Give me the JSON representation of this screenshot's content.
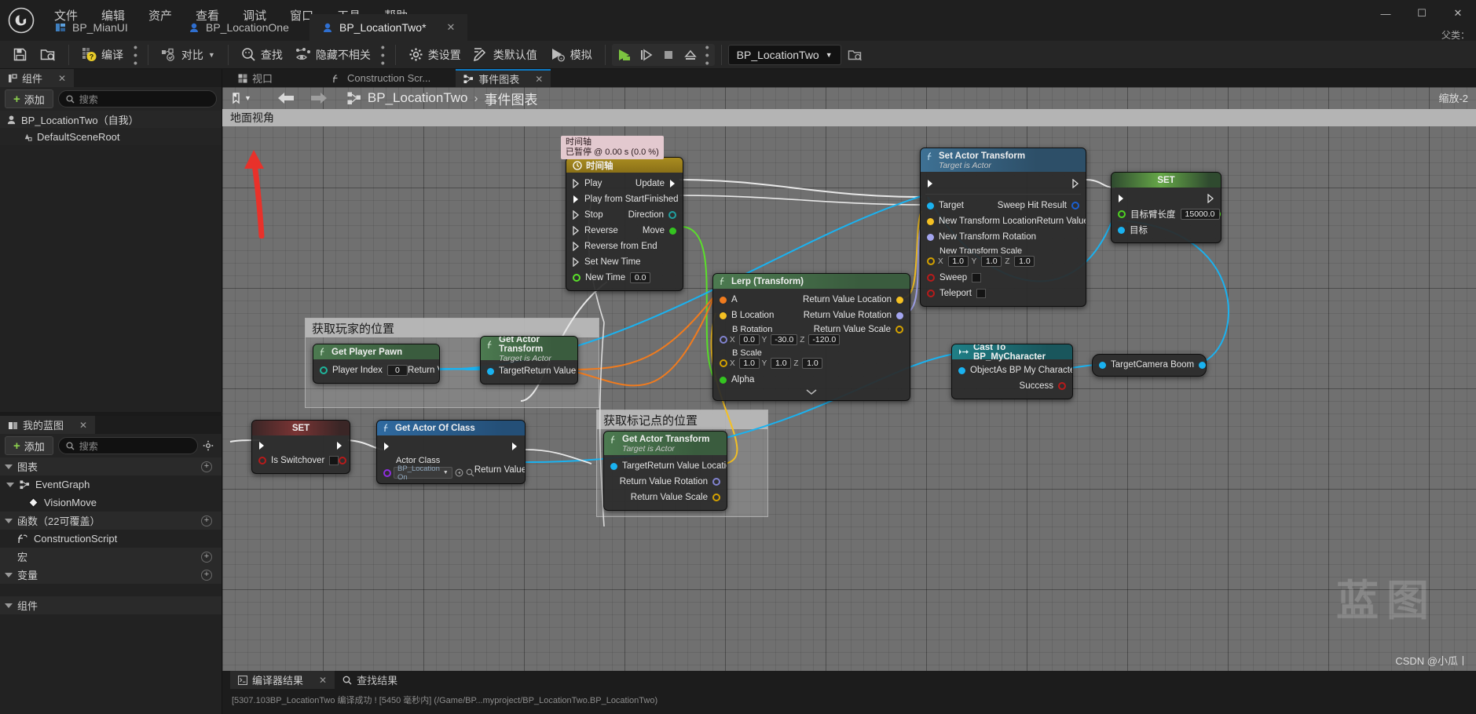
{
  "app": {
    "logo": "unreal-engine-logo",
    "menu": [
      "文件",
      "编辑",
      "资产",
      "查看",
      "调试",
      "窗口",
      "工具",
      "帮助"
    ],
    "window_buttons": {
      "minimize": "—",
      "maximize": "☐",
      "close": "✕"
    },
    "parent_class_label": "父类："
  },
  "asset_tabs": [
    {
      "label": "BP_MianUI",
      "icon": "widget-icon",
      "active": false,
      "closable": false
    },
    {
      "label": "BP_LocationOne",
      "icon": "blueprint-actor-icon",
      "active": false,
      "closable": false
    },
    {
      "label": "BP_LocationTwo*",
      "icon": "blueprint-actor-icon",
      "active": true,
      "closable": true,
      "close": "✕"
    }
  ],
  "toolbar": {
    "save": "保存",
    "browse": "在内容浏览器中浏览",
    "compile": "编译",
    "diff": "对比",
    "find": "查找",
    "hide_unrelated": "隐藏不相关",
    "class_settings": "类设置",
    "class_defaults": "类默认值",
    "simulate": "模拟",
    "play": "运行",
    "step": "逐帧",
    "stop": "停止",
    "eject": "弹出",
    "debug_filter": "BP_LocationTwo",
    "debug_filter_search": "search-icon"
  },
  "components_panel": {
    "tab_label": "组件",
    "tab_close": "✕",
    "add_label": "添加",
    "search_placeholder": "搜索",
    "items": [
      {
        "label": "BP_LocationTwo（自我）",
        "icon": "blueprint-actor-icon",
        "depth": 0
      },
      {
        "label": "DefaultSceneRoot",
        "icon": "scene-root-icon",
        "depth": 1
      }
    ]
  },
  "myblueprint_panel": {
    "tab_label": "我的蓝图",
    "tab_close": "✕",
    "add_label": "添加",
    "search_placeholder": "搜索",
    "settings_icon": "gear-icon",
    "sections": [
      {
        "label": "图表",
        "expandable": true,
        "has_add": true,
        "items": [
          {
            "label": "EventGraph",
            "icon": "event-graph-icon",
            "depth": 1,
            "expandable": true
          },
          {
            "label": "VisionMove",
            "icon": "event-node-icon",
            "depth": 2
          }
        ]
      },
      {
        "label": "函数（22可覆盖）",
        "expandable": true,
        "has_add": true,
        "items": [
          {
            "label": "ConstructionScript",
            "icon": "function-icon",
            "depth": 1
          }
        ]
      },
      {
        "label": "宏",
        "expandable": false,
        "has_add": true,
        "items": []
      },
      {
        "label": "变量",
        "expandable": true,
        "has_add": true,
        "items": []
      },
      {
        "label": "组件",
        "expandable": true,
        "has_add": false,
        "items": []
      }
    ]
  },
  "graph_tabs": [
    {
      "label": "视口",
      "icon": "viewport-icon",
      "active": false
    },
    {
      "label": "Construction Scr...",
      "icon": "function-icon",
      "active": false
    },
    {
      "label": "事件图表",
      "icon": "event-graph-icon",
      "active": true,
      "close": "✕"
    }
  ],
  "graph_header": {
    "bookmark_icon": "bookmark-icon",
    "back_icon": "arrow-left-icon",
    "forward_icon": "arrow-right-icon",
    "graph_icon": "event-graph-icon",
    "breadcrumb_root": "BP_LocationTwo",
    "breadcrumb_sep": "›",
    "breadcrumb_leaf": "事件图表",
    "zoom_label": "缩放-2",
    "ground_view_label": "地面视角",
    "watermark": "蓝图",
    "csdn": "CSDN @小瓜丨"
  },
  "comments": [
    {
      "id": "player-pos",
      "title": "获取玩家的位置"
    },
    {
      "id": "marker-pos",
      "title": "获取标记点的位置"
    }
  ],
  "timeline_tooltip": {
    "line1": "时间轴",
    "line2": "已暂停 @ 0.00 s (0.0 %)"
  },
  "nodes": {
    "timeline": {
      "title": "时间轴",
      "icon": "clock-icon",
      "inputs": [
        "Play",
        "Play from Start",
        "Stop",
        "Reverse",
        "Reverse from End",
        "Set New Time"
      ],
      "new_time_label": "New Time",
      "new_time_value": "0.0",
      "outputs": [
        "Update",
        "Finished",
        "Direction",
        "Move"
      ]
    },
    "set_actor_transform": {
      "title": "Set Actor Transform",
      "subtitle": "Target is Actor",
      "icon": "function-f-icon",
      "inputs": [
        "Target",
        "New Transform Location",
        "New Transform Rotation"
      ],
      "scale_label": "New Transform Scale",
      "scale": {
        "x": "1.0",
        "y": "1.0",
        "z": "1.0"
      },
      "sweep_label": "Sweep",
      "teleport_label": "Teleport",
      "outputs": [
        "Sweep Hit Result",
        "Return Value"
      ]
    },
    "set_arm_length": {
      "title": "SET",
      "value_label": "目标臂长度",
      "value": "15000.0",
      "target_label": "目标"
    },
    "lerp_transform": {
      "title": "Lerp (Transform)",
      "icon": "function-f-icon",
      "inputs": [
        "A",
        "B Location"
      ],
      "b_rotation_label": "B Rotation",
      "b_rotation": {
        "x": "0.0",
        "y": "-30.0",
        "z": "-120.0"
      },
      "b_scale_label": "B Scale",
      "b_scale": {
        "x": "1.0",
        "y": "1.0",
        "z": "1.0"
      },
      "alpha_label": "Alpha",
      "outputs": [
        "Return Value Location",
        "Return Value Rotation",
        "Return Value Scale"
      ],
      "expand_icon": "chevron-down-icon"
    },
    "get_player_pawn": {
      "title": "Get Player Pawn",
      "icon": "function-f-icon",
      "input_label": "Player Index",
      "input_value": "0",
      "output_label": "Return Value"
    },
    "get_actor_transform_player": {
      "title": "Get Actor Transform",
      "subtitle": "Target is Actor",
      "icon": "function-f-icon",
      "input_label": "Target",
      "output_label": "Return Value"
    },
    "get_actor_transform_marker": {
      "title": "Get Actor Transform",
      "subtitle": "Target is Actor",
      "icon": "function-f-icon",
      "input_label": "Target",
      "outputs": [
        "Return Value Location",
        "Return Value Rotation",
        "Return Value Scale"
      ]
    },
    "set_is_switchover": {
      "title": "SET",
      "label": "Is Switchover",
      "checked": false
    },
    "get_actor_of_class": {
      "title": "Get Actor Of Class",
      "icon": "function-f-icon",
      "class_label": "Actor Class",
      "class_value": "BP_Location On",
      "dropdown_icon": "chevron-down-icon",
      "browse_icon": "browse-icon",
      "search_icon": "search-icon",
      "output_label": "Return Value"
    },
    "cast_to_character": {
      "title": "Cast To BP_MyCharacter",
      "icon": "cast-icon",
      "input_label": "Object",
      "outputs": [
        "As BP My Character",
        "Success"
      ]
    },
    "camera_boom": {
      "input_label": "Target",
      "output_label": "Camera Boom"
    }
  },
  "bottom_panel": {
    "tabs": [
      {
        "label": "编译器结果",
        "icon": "compiler-results-icon",
        "active": true,
        "close": "✕"
      },
      {
        "label": "查找结果",
        "icon": "search-icon",
        "active": false
      }
    ],
    "log_line": "[5307.103BP_LocationTwo  编译成功 ! [5450 毫秒内] (/Game/BP...myproject/BP_LocationTwo.BP_LocationTwo)"
  },
  "colors": {
    "exec_white": "#ffffff",
    "object_blue": "#1ab2f0",
    "transform_orange": "#f07b1e",
    "vector_yellow": "#f4c023",
    "rotator_purple": "#a3a5ef",
    "bool_red": "#b81b1b",
    "float_green": "#5ae02a",
    "class_purple": "#8f2ee0",
    "wildcard_teal": "#20a0a0",
    "accent_blue": "#0d7ac4",
    "add_green": "#8ccf4e"
  }
}
